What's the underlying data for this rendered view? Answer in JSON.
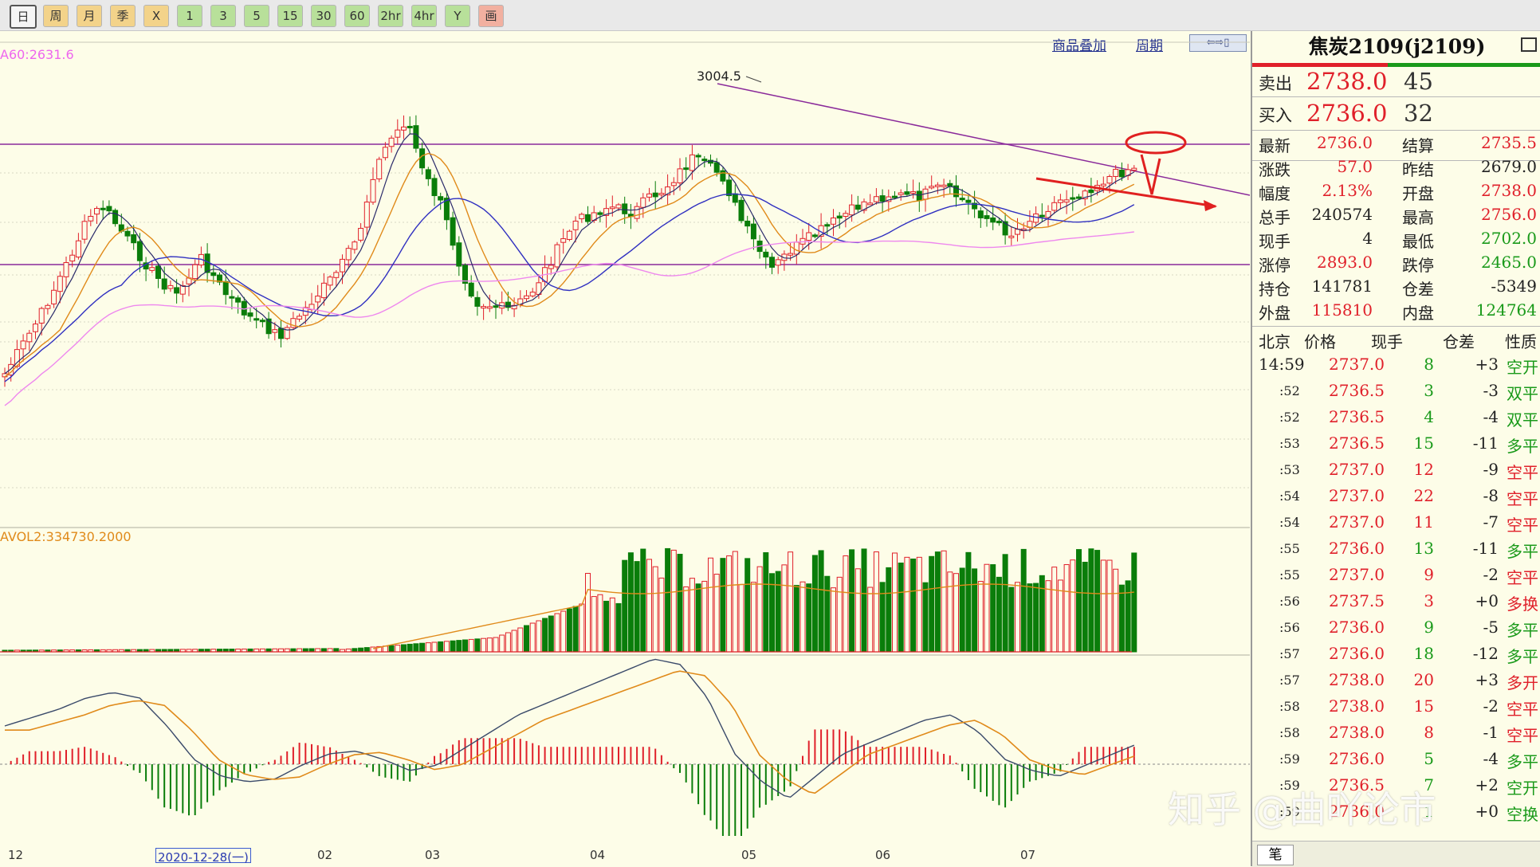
{
  "toolbar": {
    "buttons": [
      "日",
      "周",
      "月",
      "季",
      "X",
      "1",
      "3",
      "5",
      "15",
      "30",
      "60",
      "2hr",
      "4hr",
      "Y",
      "画"
    ]
  },
  "chart": {
    "links": [
      "商品叠加",
      "周期"
    ],
    "ma_label": "A60:2631.6",
    "peak_label": "3004.5",
    "vol_label": "AVOL2:334730.2000",
    "date_axis": [
      "12",
      "2020-12-28(一)",
      "02",
      "03",
      "04",
      "05",
      "06",
      "07"
    ],
    "colors": {
      "up": "#e0202a",
      "down": "#0a7d0a",
      "ma5": "#2a2a6a",
      "ma10": "#e08a1a",
      "ma20": "#3030c0",
      "ma60": "#ee88ee",
      "trend": "#8a2a9a",
      "annot": "#e02020"
    }
  },
  "quote": {
    "title": "焦炭2109(j2109)",
    "sell": {
      "label": "卖出",
      "price": "2738.0",
      "qty": "45"
    },
    "buy": {
      "label": "买入",
      "price": "2736.0",
      "qty": "32"
    },
    "stats": [
      [
        "最新",
        "2736.0",
        "结算",
        "2735.5"
      ],
      [
        "涨跌",
        "57.0",
        "昨结",
        "2679.0"
      ],
      [
        "幅度",
        "2.13%",
        "开盘",
        "2738.0"
      ],
      [
        "总手",
        "240574",
        "最高",
        "2756.0"
      ],
      [
        "现手",
        "4",
        "最低",
        "2702.0"
      ],
      [
        "涨停",
        "2893.0",
        "跌停",
        "2465.0"
      ],
      [
        "持仓",
        "141781",
        "仓差",
        "-5349"
      ],
      [
        "外盘",
        "115810",
        "内盘",
        "124764"
      ]
    ],
    "tick_headers": [
      "北京",
      "价格",
      "现手",
      "仓差",
      "性质"
    ],
    "ticks": [
      [
        "14:59",
        "2737.0",
        "8",
        "+3",
        "空开",
        "g"
      ],
      [
        ":52",
        "2736.5",
        "3",
        "-3",
        "双平",
        "g"
      ],
      [
        ":52",
        "2736.5",
        "4",
        "-4",
        "双平",
        "g"
      ],
      [
        ":53",
        "2736.5",
        "15",
        "-11",
        "多平",
        "g"
      ],
      [
        ":53",
        "2737.0",
        "12",
        "-9",
        "空平",
        "r"
      ],
      [
        ":54",
        "2737.0",
        "22",
        "-8",
        "空平",
        "r"
      ],
      [
        ":54",
        "2737.0",
        "11",
        "-7",
        "空平",
        "r"
      ],
      [
        ":55",
        "2736.0",
        "13",
        "-11",
        "多平",
        "g"
      ],
      [
        ":55",
        "2737.0",
        "9",
        "-2",
        "空平",
        "r"
      ],
      [
        ":56",
        "2737.5",
        "3",
        "+0",
        "多换",
        "r"
      ],
      [
        ":56",
        "2736.0",
        "9",
        "-5",
        "多平",
        "g"
      ],
      [
        ":57",
        "2736.0",
        "18",
        "-12",
        "多平",
        "g"
      ],
      [
        ":57",
        "2738.0",
        "20",
        "+3",
        "多开",
        "r"
      ],
      [
        ":58",
        "2738.0",
        "15",
        "-2",
        "空平",
        "r"
      ],
      [
        ":58",
        "2738.0",
        "8",
        "-1",
        "空平",
        "r"
      ],
      [
        ":59",
        "2736.0",
        "5",
        "-4",
        "多平",
        "g"
      ],
      [
        ":59",
        "2736.5",
        "7",
        "+2",
        "空开",
        "g"
      ],
      [
        ":59",
        "2736.0",
        "1",
        "+0",
        "空换",
        "g"
      ]
    ],
    "bottom_tab": "笔"
  },
  "watermark": "知乎 @曲吖论市"
}
